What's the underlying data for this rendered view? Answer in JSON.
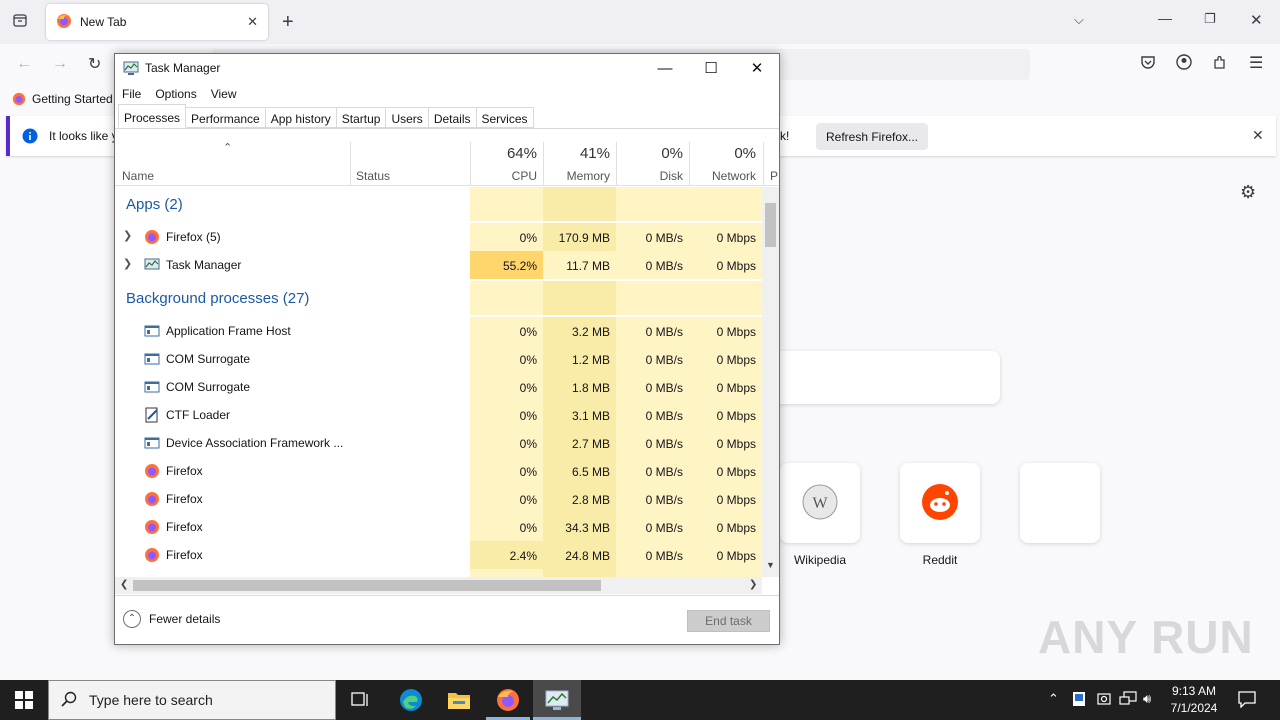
{
  "browser": {
    "tab_title": "New Tab",
    "bookmark": "Getting Started",
    "notification_text": "It looks like y",
    "notification_tail": "k!",
    "refresh_label": "Refresh Firefox...",
    "shortcuts": [
      {
        "label": "Wikipedia"
      },
      {
        "label": "Reddit"
      },
      {
        "label": ""
      }
    ]
  },
  "taskmgr": {
    "title": "Task Manager",
    "menu": [
      "File",
      "Options",
      "View"
    ],
    "tabs": [
      "Processes",
      "Performance",
      "App history",
      "Startup",
      "Users",
      "Details",
      "Services"
    ],
    "header": {
      "name": "Name",
      "status": "Status",
      "cpu_pct": "64%",
      "cpu": "CPU",
      "mem_pct": "41%",
      "mem": "Memory",
      "disk_pct": "0%",
      "disk": "Disk",
      "net_pct": "0%",
      "net": "Network",
      "power": "P"
    },
    "apps_group": "Apps (2)",
    "apps": [
      {
        "name": "Firefox (5)",
        "cpu": "0%",
        "mem": "170.9 MB",
        "disk": "0 MB/s",
        "net": "0 Mbps"
      },
      {
        "name": "Task Manager",
        "cpu": "55.2%",
        "mem": "11.7 MB",
        "disk": "0 MB/s",
        "net": "0 Mbps"
      }
    ],
    "bg_group": "Background processes (27)",
    "bg": [
      {
        "name": "Application Frame Host",
        "cpu": "0%",
        "mem": "3.2 MB",
        "disk": "0 MB/s",
        "net": "0 Mbps"
      },
      {
        "name": "COM Surrogate",
        "cpu": "0%",
        "mem": "1.2 MB",
        "disk": "0 MB/s",
        "net": "0 Mbps"
      },
      {
        "name": "COM Surrogate",
        "cpu": "0%",
        "mem": "1.8 MB",
        "disk": "0 MB/s",
        "net": "0 Mbps"
      },
      {
        "name": "CTF Loader",
        "cpu": "0%",
        "mem": "3.1 MB",
        "disk": "0 MB/s",
        "net": "0 Mbps"
      },
      {
        "name": "Device Association Framework ...",
        "cpu": "0%",
        "mem": "2.7 MB",
        "disk": "0 MB/s",
        "net": "0 Mbps"
      },
      {
        "name": "Firefox",
        "cpu": "0%",
        "mem": "6.5 MB",
        "disk": "0 MB/s",
        "net": "0 Mbps"
      },
      {
        "name": "Firefox",
        "cpu": "0%",
        "mem": "2.8 MB",
        "disk": "0 MB/s",
        "net": "0 Mbps"
      },
      {
        "name": "Firefox",
        "cpu": "0%",
        "mem": "34.3 MB",
        "disk": "0 MB/s",
        "net": "0 Mbps"
      },
      {
        "name": "Firefox",
        "cpu": "2.4%",
        "mem": "24.8 MB",
        "disk": "0 MB/s",
        "net": "0 Mbps"
      }
    ],
    "fewer_details": "Fewer details",
    "end_task": "End task"
  },
  "taskbar": {
    "search_placeholder": "Type here to search",
    "time": "9:13 AM",
    "date": "7/1/2024"
  },
  "watermark": "ANY RUN",
  "colors": {
    "group_header": "#1b59a6",
    "heat_light": "#fff4c4",
    "heat_mid": "#f9eca8",
    "heat_high": "#ffd66b"
  }
}
